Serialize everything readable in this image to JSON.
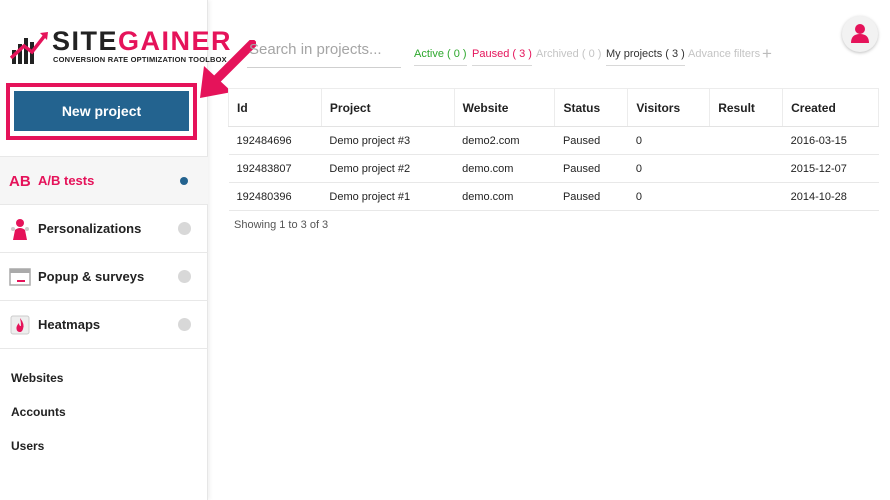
{
  "brand": {
    "name_part1": "SITE",
    "name_part2": "GAINER",
    "tagline": "CONVERSION RATE OPTIMIZATION TOOLBOX"
  },
  "sidebar": {
    "new_project": "New project",
    "nav": [
      {
        "label": "A/B tests",
        "icon": "ab-icon",
        "active": true
      },
      {
        "label": "Personalizations",
        "icon": "person-icon",
        "active": false
      },
      {
        "label": "Popup & surveys",
        "icon": "popup-icon",
        "active": false
      },
      {
        "label": "Heatmaps",
        "icon": "flame-icon",
        "active": false
      }
    ],
    "links": [
      "Websites",
      "Accounts",
      "Users"
    ]
  },
  "search": {
    "placeholder": "Search in projects..."
  },
  "filters": {
    "active": "Active ( 0 )",
    "paused": "Paused ( 3 )",
    "archived": "Archived ( 0 )",
    "my_projects": "My projects ( 3 )",
    "advanced": "Advance filters",
    "add": "+"
  },
  "table": {
    "columns": [
      "Id",
      "Project",
      "Website",
      "Status",
      "Visitors",
      "Result",
      "Created"
    ],
    "rows": [
      [
        "192484696",
        "Demo project #3",
        "demo2.com",
        "Paused",
        "0",
        "",
        "2016-03-15"
      ],
      [
        "192483807",
        "Demo project #2",
        "demo.com",
        "Paused",
        "0",
        "",
        "2015-12-07"
      ],
      [
        "192480396",
        "Demo project #1",
        "demo.com",
        "Paused",
        "0",
        "",
        "2014-10-28"
      ]
    ],
    "showing": "Showing 1 to 3 of 3"
  },
  "colors": {
    "accent": "#e5135a",
    "primary": "#23638f",
    "active_green": "#2da82d"
  }
}
